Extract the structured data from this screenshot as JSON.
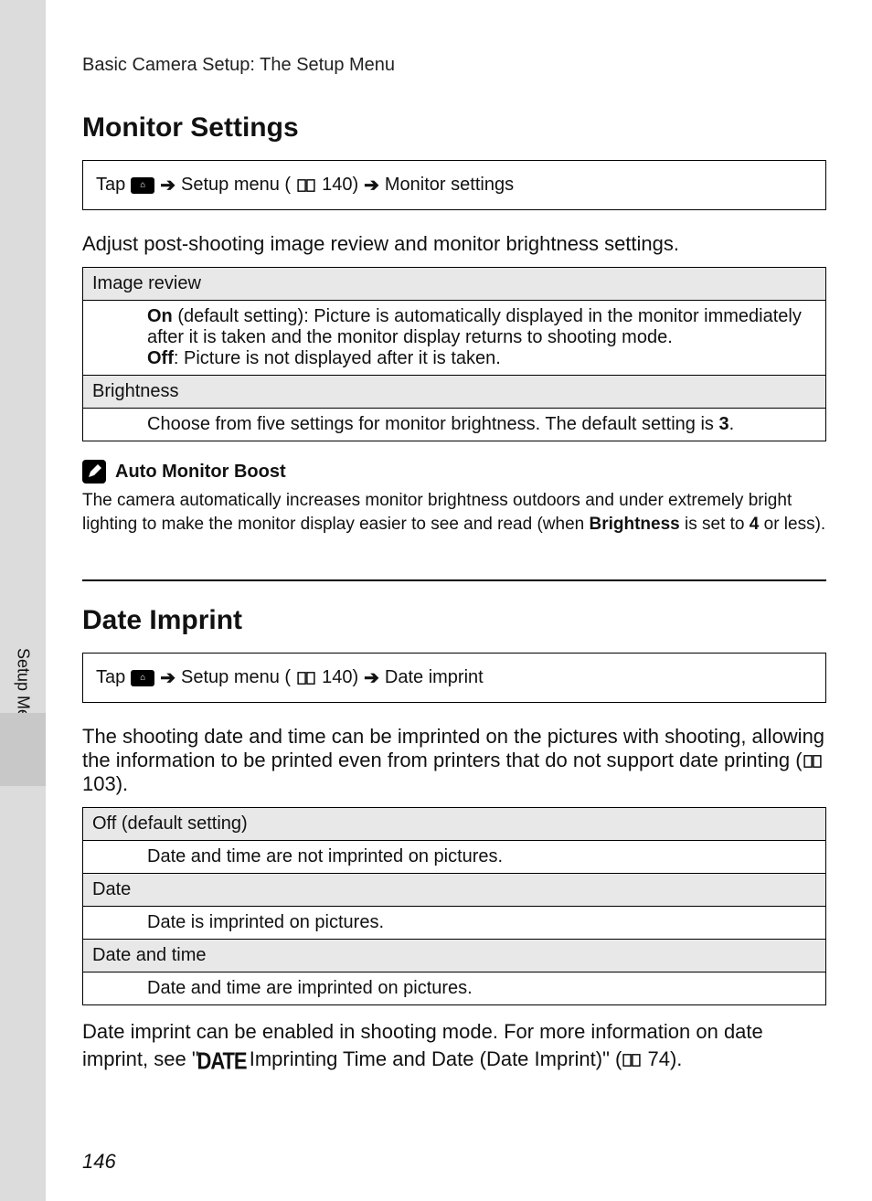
{
  "header": {
    "running_head": "Basic Camera Setup: The Setup Menu",
    "side_tab": "Setup Menu",
    "page_number": "146"
  },
  "section1": {
    "title": "Monitor Settings",
    "nav": {
      "tap": "Tap",
      "home": "HOME",
      "part1": "Setup menu (",
      "ref1a": "140)",
      "arrow": "➔",
      "target": "Monitor settings"
    },
    "intro": "Adjust post-shooting image review and monitor brightness settings.",
    "rows": [
      {
        "head": "Image review",
        "body_parts": {
          "on": "On",
          "on_text": " (default setting): Picture is automatically displayed in the monitor immediately after it is taken and the monitor display returns to shooting mode.",
          "off": "Off",
          "off_text": ": Picture is not displayed after it is taken."
        }
      },
      {
        "head": "Brightness",
        "body_parts": {
          "text_a": "Choose from five settings for monitor brightness. The default setting is ",
          "bold": "3",
          "text_b": "."
        }
      }
    ],
    "note": {
      "title": "Auto Monitor Boost",
      "body_a": "The camera automatically increases monitor brightness outdoors and under extremely bright lighting to make the monitor display easier to see and read (when ",
      "body_bold1": "Brightness",
      "body_b": " is set to ",
      "body_bold2": "4",
      "body_c": " or less)."
    }
  },
  "section2": {
    "title": "Date Imprint",
    "nav": {
      "tap": "Tap",
      "home": "HOME",
      "part1": "Setup menu (",
      "ref1a": "140)",
      "arrow": "➔",
      "target": "Date imprint"
    },
    "intro_a": "The shooting date and time can be imprinted on the pictures with shooting, allowing the information to be printed even from printers that do not support date printing (",
    "intro_ref": "103).",
    "rows": [
      {
        "head": "Off (default setting)",
        "body": "Date and time are not imprinted on pictures."
      },
      {
        "head": "Date",
        "body": "Date is imprinted on pictures."
      },
      {
        "head": "Date and time",
        "body": "Date and time are imprinted on pictures."
      }
    ],
    "footnote_a": "Date imprint can be enabled in shooting mode. For more information on date imprint, see \"",
    "footnote_badge": "DATE",
    "footnote_b": " Imprinting Time and Date (Date Imprint)\" (",
    "footnote_ref": "74)."
  }
}
